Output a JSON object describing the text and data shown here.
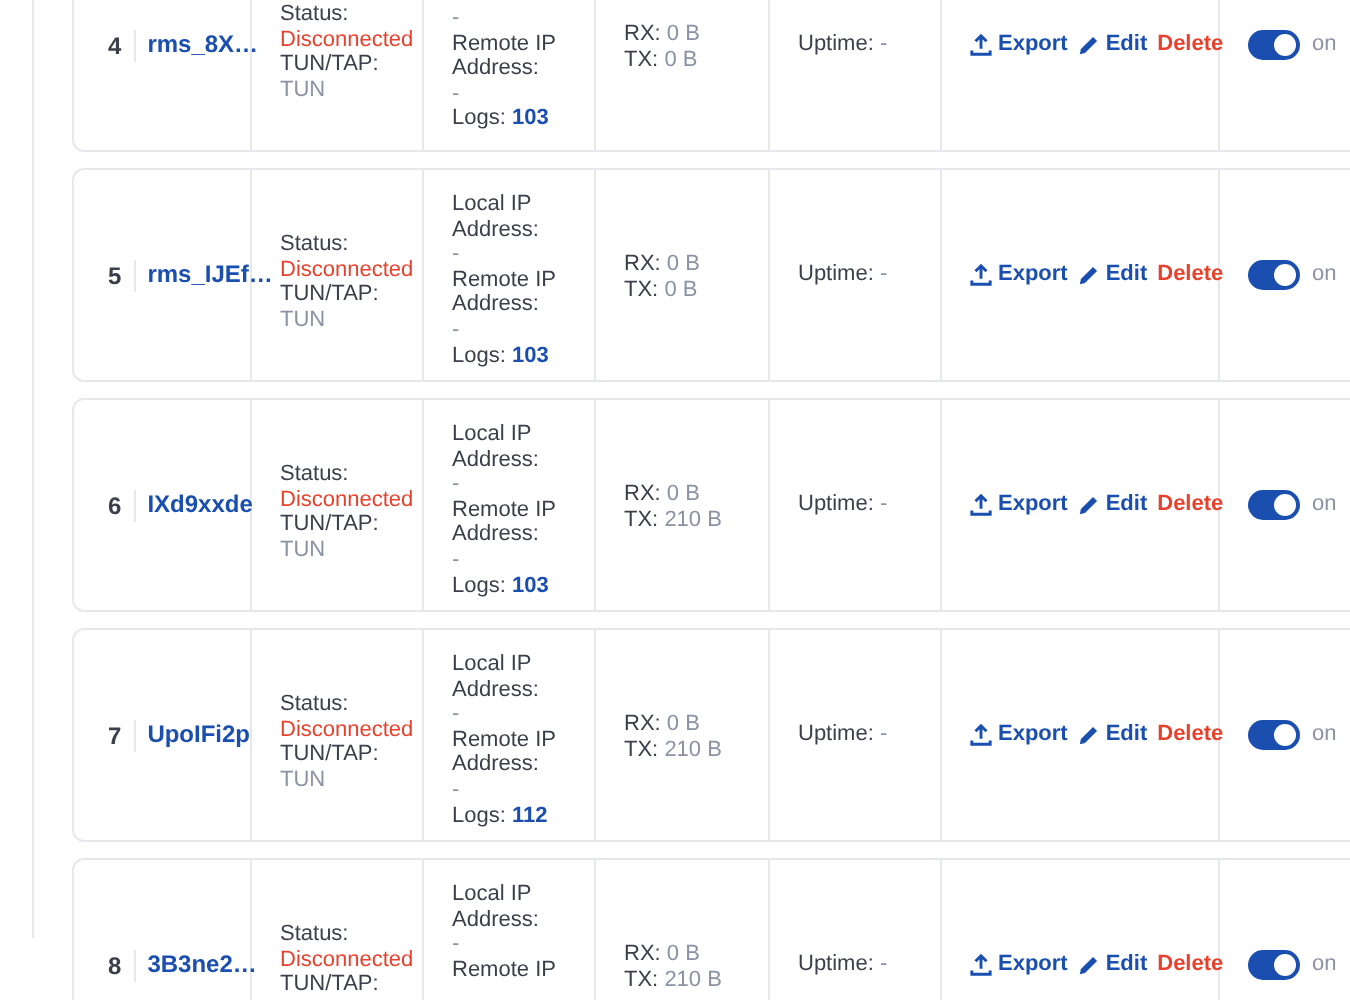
{
  "rows": [
    {
      "index": "4",
      "name": "rms_8X…",
      "status_label": "Status:",
      "status": "Disconnected",
      "connected": false,
      "tuntap_label": "TUN/TAP:",
      "tuntap": "TUN",
      "local_ip": "-",
      "remote_ip_label": "Remote IP Address:",
      "remote_ip": "-",
      "logs_label": "Logs:",
      "logs": "103",
      "rx_label": "RX:",
      "rx": "0 B",
      "tx_label": "TX:",
      "tx": "0 B",
      "uptime_label": "Uptime:",
      "uptime": "-",
      "actions": [
        {
          "kind": "export",
          "label": "Export"
        },
        {
          "kind": "edit",
          "label": "Edit"
        },
        {
          "kind": "delete",
          "label": "Delete"
        }
      ],
      "enabled": true,
      "toggle_label": "on"
    },
    {
      "index": "5",
      "name": "rms_IJEf…",
      "status_label": "Status:",
      "status": "Disconnected",
      "connected": false,
      "tuntap_label": "TUN/TAP:",
      "tuntap": "TUN",
      "local_ip_label": "Local IP Address:",
      "local_ip": "-",
      "remote_ip_label": "Remote IP Address:",
      "remote_ip": "-",
      "logs_label": "Logs:",
      "logs": "103",
      "rx_label": "RX:",
      "rx": "0 B",
      "tx_label": "TX:",
      "tx": "0 B",
      "uptime_label": "Uptime:",
      "uptime": "-",
      "actions": [
        {
          "kind": "export",
          "label": "Export"
        },
        {
          "kind": "edit",
          "label": "Edit"
        },
        {
          "kind": "delete",
          "label": "Delete"
        }
      ],
      "enabled": true,
      "toggle_label": "on"
    },
    {
      "index": "6",
      "name": "IXd9xxde",
      "status_label": "Status:",
      "status": "Disconnected",
      "connected": false,
      "tuntap_label": "TUN/TAP:",
      "tuntap": "TUN",
      "local_ip_label": "Local IP Address:",
      "local_ip": "-",
      "remote_ip_label": "Remote IP Address:",
      "remote_ip": "-",
      "logs_label": "Logs:",
      "logs": "103",
      "rx_label": "RX:",
      "rx": "0 B",
      "tx_label": "TX:",
      "tx": "210 B",
      "uptime_label": "Uptime:",
      "uptime": "-",
      "actions": [
        {
          "kind": "export",
          "label": "Export"
        },
        {
          "kind": "edit",
          "label": "Edit"
        },
        {
          "kind": "delete",
          "label": "Delete"
        }
      ],
      "enabled": true,
      "toggle_label": "on"
    },
    {
      "index": "7",
      "name": "UpoIFi2p",
      "status_label": "Status:",
      "status": "Disconnected",
      "connected": false,
      "tuntap_label": "TUN/TAP:",
      "tuntap": "TUN",
      "local_ip_label": "Local IP Address:",
      "local_ip": "-",
      "remote_ip_label": "Remote IP Address:",
      "remote_ip": "-",
      "logs_label": "Logs:",
      "logs": "112",
      "rx_label": "RX:",
      "rx": "0 B",
      "tx_label": "TX:",
      "tx": "210 B",
      "uptime_label": "Uptime:",
      "uptime": "-",
      "actions": [
        {
          "kind": "export",
          "label": "Export"
        },
        {
          "kind": "edit",
          "label": "Edit"
        },
        {
          "kind": "delete",
          "label": "Delete"
        }
      ],
      "enabled": true,
      "toggle_label": "on"
    },
    {
      "index": "8",
      "name": "3B3ne2…",
      "status_label": "Status:",
      "status": "Disconnected",
      "connected": false,
      "tuntap_label": "TUN/TAP:",
      "local_ip_label": "Local IP Address:",
      "local_ip": "-",
      "remote_ip_label": "Remote IP",
      "rx_label": "RX:",
      "rx": "0 B",
      "tx_label": "TX:",
      "tx": "210 B",
      "uptime_label": "Uptime:",
      "uptime": "-",
      "actions": [
        {
          "kind": "export",
          "label": "Export"
        },
        {
          "kind": "edit",
          "label": "Edit"
        },
        {
          "kind": "delete",
          "label": "Delete"
        }
      ],
      "enabled": true,
      "toggle_label": "on"
    }
  ]
}
